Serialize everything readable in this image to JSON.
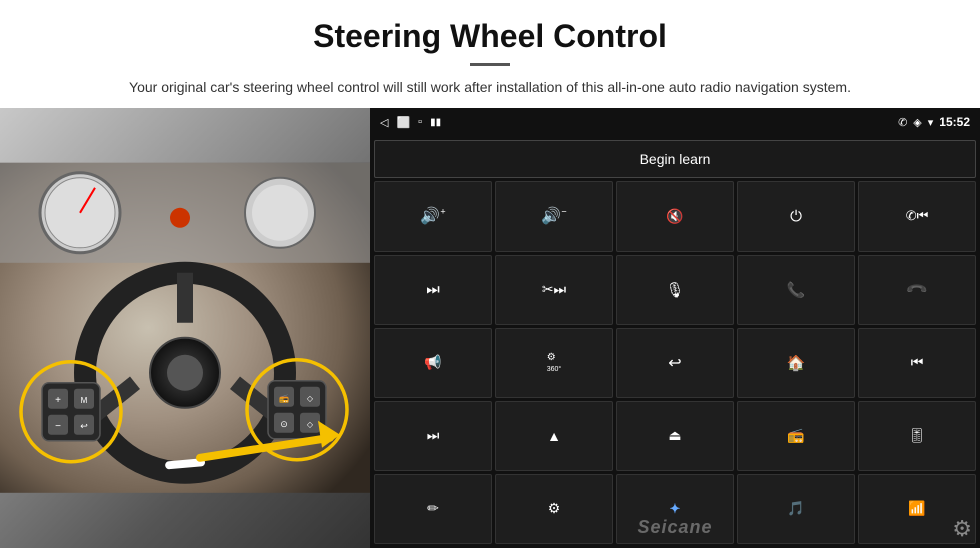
{
  "page": {
    "title": "Steering Wheel Control",
    "divider": true,
    "subtitle": "Your original car's steering wheel control will still work after installation of this all-in-one auto radio navigation system."
  },
  "statusbar": {
    "time": "15:52",
    "icons": {
      "back": "◁",
      "home": "⬜",
      "recents": "▫",
      "phone": "✆",
      "location": "◈",
      "wifi": "▾",
      "battery": "▮▮"
    }
  },
  "beginLearn": {
    "label": "Begin learn"
  },
  "controls": {
    "rows": [
      [
        {
          "icon": "🔊+",
          "label": "vol-up"
        },
        {
          "icon": "🔊−",
          "label": "vol-down"
        },
        {
          "icon": "🔇",
          "label": "mute"
        },
        {
          "icon": "⏻",
          "label": "power"
        },
        {
          "icon": "⏮",
          "label": "prev-phone"
        }
      ],
      [
        {
          "icon": "⏭",
          "label": "next"
        },
        {
          "icon": "⏩",
          "label": "fast-forward"
        },
        {
          "icon": "🎙",
          "label": "mic"
        },
        {
          "icon": "📞",
          "label": "phone"
        },
        {
          "icon": "📵",
          "label": "hang-up"
        }
      ],
      [
        {
          "icon": "📢",
          "label": "speaker"
        },
        {
          "icon": "360°",
          "label": "camera-360"
        },
        {
          "icon": "↩",
          "label": "back"
        },
        {
          "icon": "🏠",
          "label": "home"
        },
        {
          "icon": "⏮⏮",
          "label": "prev-prev"
        }
      ],
      [
        {
          "icon": "⏭⏭",
          "label": "next-next"
        },
        {
          "icon": "▲",
          "label": "navigate"
        },
        {
          "icon": "⏏",
          "label": "eject"
        },
        {
          "icon": "📻",
          "label": "radio"
        },
        {
          "icon": "🎚",
          "label": "equalizer"
        }
      ],
      [
        {
          "icon": "✏",
          "label": "pen"
        },
        {
          "icon": "⚙",
          "label": "settings-btn"
        },
        {
          "icon": "✦",
          "label": "bluetooth"
        },
        {
          "icon": "🎵",
          "label": "music"
        },
        {
          "icon": "📶",
          "label": "signal"
        }
      ]
    ]
  },
  "watermark": {
    "text": "Seicane"
  },
  "gear": {
    "symbol": "⚙"
  }
}
